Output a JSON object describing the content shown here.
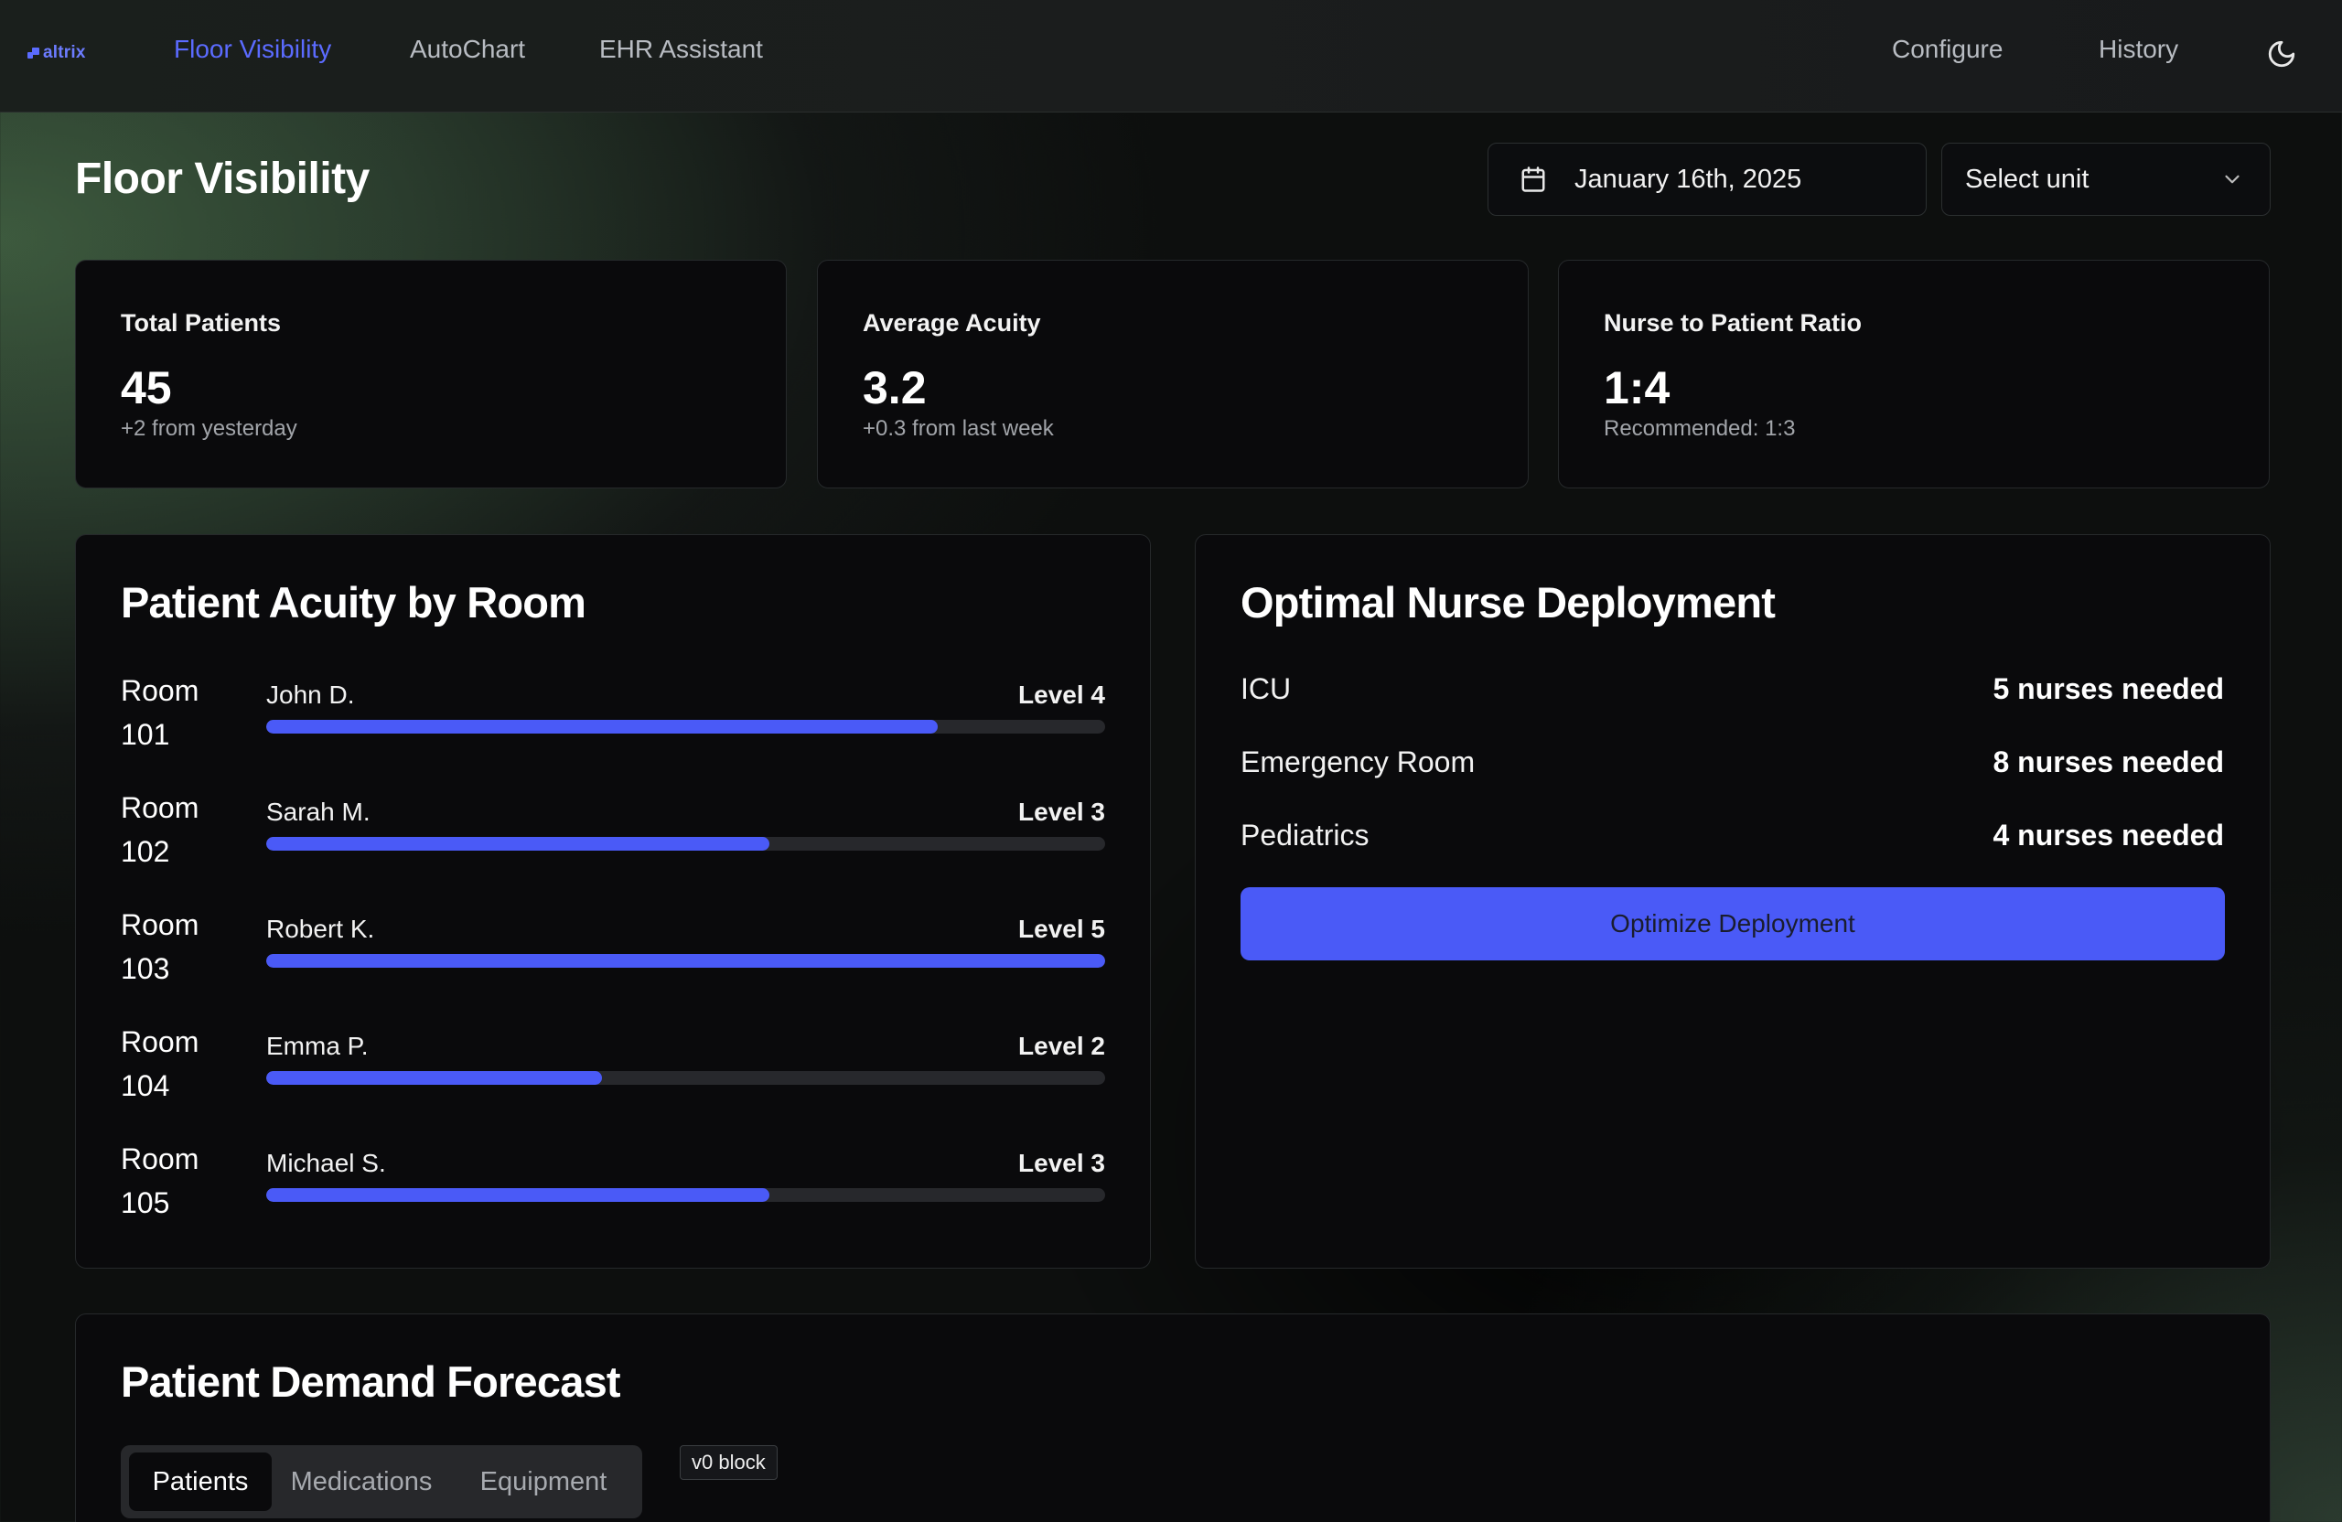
{
  "nav": {
    "logo_text": "altrix",
    "links": [
      "Floor Visibility",
      "AutoChart",
      "EHR Assistant"
    ],
    "right_links": [
      "Configure",
      "History"
    ],
    "theme_icon": "moon-icon",
    "accent_color": "#5b6bff"
  },
  "header": {
    "title": "Floor Visibility",
    "date": "January 16th, 2025",
    "unit_select": "Select unit"
  },
  "stats": [
    {
      "label": "Total Patients",
      "value": "45",
      "sub": "+2 from yesterday"
    },
    {
      "label": "Average Acuity",
      "value": "3.2",
      "sub": "+0.3 from last week"
    },
    {
      "label": "Nurse to Patient Ratio",
      "value": "1:4",
      "sub": "Recommended: 1:3"
    }
  ],
  "acuity": {
    "title": "Patient Acuity by Room",
    "bar_color": "#4a5af7",
    "rows": [
      {
        "room": "Room",
        "room_num": "101",
        "patient": "John D.",
        "level_label": "Level 4",
        "level": 4
      },
      {
        "room": "Room",
        "room_num": "102",
        "patient": "Sarah M.",
        "level_label": "Level 3",
        "level": 3
      },
      {
        "room": "Room",
        "room_num": "103",
        "patient": "Robert K.",
        "level_label": "Level 5",
        "level": 5
      },
      {
        "room": "Room",
        "room_num": "104",
        "patient": "Emma P.",
        "level_label": "Level 2",
        "level": 2
      },
      {
        "room": "Room",
        "room_num": "105",
        "patient": "Michael S.",
        "level_label": "Level 3",
        "level": 3
      }
    ]
  },
  "deployment": {
    "title": "Optimal Nurse Deployment",
    "rows": [
      {
        "unit": "ICU",
        "need": "5 nurses needed"
      },
      {
        "unit": "Emergency Room",
        "need": "8 nurses needed"
      },
      {
        "unit": "Pediatrics",
        "need": "4 nurses needed"
      }
    ],
    "button": "Optimize Deployment"
  },
  "forecast": {
    "title": "Patient Demand Forecast",
    "tabs": [
      "Patients",
      "Medications",
      "Equipment"
    ],
    "badge": "v0 block"
  }
}
